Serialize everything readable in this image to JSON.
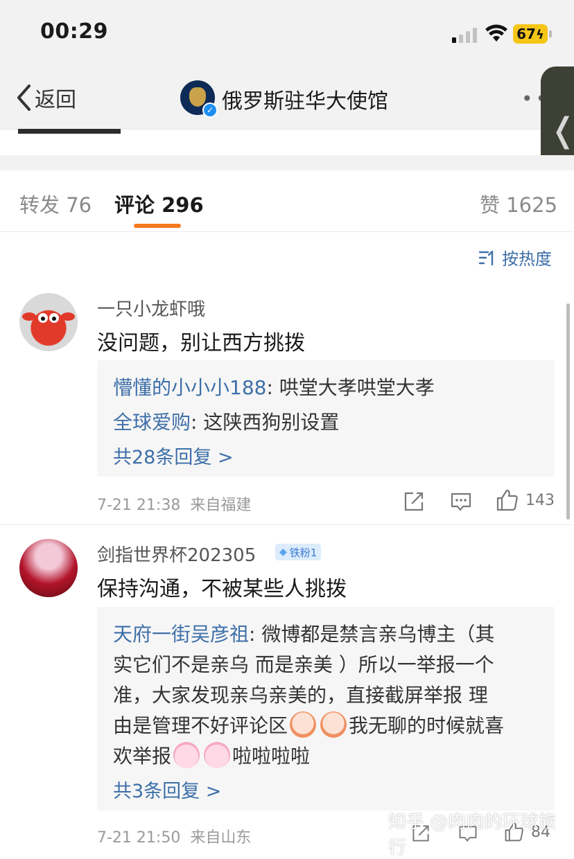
{
  "status_bar": {
    "time": "00:29",
    "battery": "67"
  },
  "nav": {
    "back_label": "返回",
    "title": "俄罗斯驻华大使馆"
  },
  "tabs": {
    "repost": "转发 76",
    "comments": "评论 296",
    "likes": "赞 1625"
  },
  "sort": {
    "label": "按热度"
  },
  "comments": [
    {
      "username": "一只小龙虾哦",
      "text": "没问题，别让西方挑拨",
      "replies": [
        {
          "user": "懵懂的小小小188",
          "text": ": 哄堂大孝哄堂大孝"
        },
        {
          "user": "全球爱购",
          "text": ": 这陕西狗别设置"
        }
      ],
      "more_replies": "共28条回复 >",
      "time": "7-21 21:38",
      "location": "来自福建",
      "likes": "143"
    },
    {
      "username": "剑指世界杯202305",
      "badge": "铁粉1",
      "text": "保持沟通，不被某些人挑拨",
      "reply": {
        "user": "天府一街吴彦祖",
        "line1": ": 微博都是禁言亲乌博主（其",
        "line2": "实它们不是亲乌 而是亲美 ）所以一举报一个",
        "line3": "准，大家发现亲乌亲美的，直接截屏举报  理",
        "line4_a": "由是管理不好评论区",
        "line4_b": "我无聊的时候就喜",
        "line5": "啦啦啦啦"
      },
      "more_replies": "共3条回复 >",
      "time": "7-21 21:50",
      "location": "来自山东",
      "likes": "84"
    }
  ],
  "watermark": "知乎 @肉肉的环球旅行"
}
